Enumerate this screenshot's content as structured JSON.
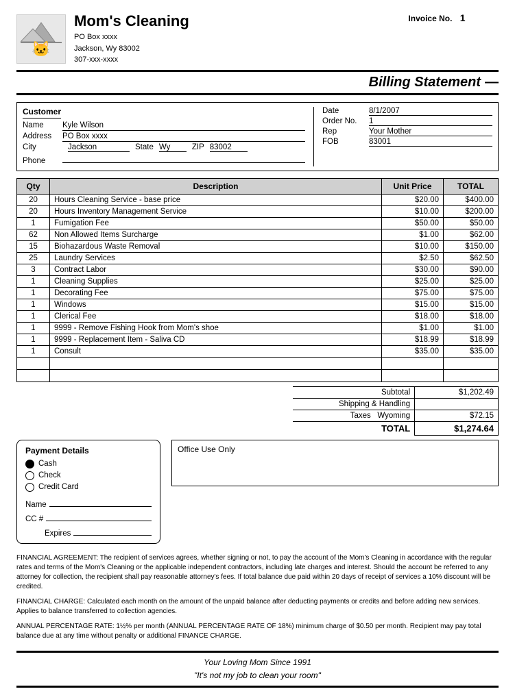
{
  "company": {
    "name": "Mom's Cleaning",
    "address_line1": "PO Box xxxx",
    "address_line2": "Jackson, Wy  83002",
    "phone": "307-xxx-xxxx"
  },
  "invoice": {
    "label": "Invoice No.",
    "number": "1"
  },
  "billing_statement_title": "Billing Statement",
  "customer": {
    "section_title": "Customer",
    "name_label": "Name",
    "name_value": "Kyle Wilson",
    "address_label": "Address",
    "address_value": "PO Box xxxx",
    "city_label": "City",
    "city_value": "Jackson",
    "state_label": "State",
    "state_value": "Wy",
    "zip_label": "ZIP",
    "zip_value": "83002",
    "phone_label": "Phone",
    "phone_value": ""
  },
  "order_info": {
    "date_label": "Date",
    "date_value": "8/1/2007",
    "order_no_label": "Order No.",
    "order_no_value": "1",
    "rep_label": "Rep",
    "rep_value": "Your Mother",
    "fob_label": "FOB",
    "fob_value": "83001"
  },
  "table": {
    "headers": [
      "Qty",
      "Description",
      "Unit Price",
      "TOTAL"
    ],
    "rows": [
      {
        "qty": "20",
        "desc": "Hours Cleaning Service - base price",
        "unit_price": "$20.00",
        "total": "$400.00"
      },
      {
        "qty": "20",
        "desc": "Hours Inventory Management Service",
        "unit_price": "$10.00",
        "total": "$200.00"
      },
      {
        "qty": "1",
        "desc": "Fumigation Fee",
        "unit_price": "$50.00",
        "total": "$50.00"
      },
      {
        "qty": "62",
        "desc": "Non Allowed Items Surcharge",
        "unit_price": "$1.00",
        "total": "$62.00"
      },
      {
        "qty": "15",
        "desc": "Biohazardous Waste Removal",
        "unit_price": "$10.00",
        "total": "$150.00"
      },
      {
        "qty": "25",
        "desc": "Laundry Services",
        "unit_price": "$2.50",
        "total": "$62.50"
      },
      {
        "qty": "3",
        "desc": "Contract Labor",
        "unit_price": "$30.00",
        "total": "$90.00"
      },
      {
        "qty": "1",
        "desc": "Cleaning Supplies",
        "unit_price": "$25.00",
        "total": "$25.00"
      },
      {
        "qty": "1",
        "desc": "Decorating Fee",
        "unit_price": "$75.00",
        "total": "$75.00"
      },
      {
        "qty": "1",
        "desc": "Windows",
        "unit_price": "$15.00",
        "total": "$15.00"
      },
      {
        "qty": "1",
        "desc": "Clerical Fee",
        "unit_price": "$18.00",
        "total": "$18.00"
      },
      {
        "qty": "1",
        "desc": "9999 - Remove Fishing Hook from Mom's shoe",
        "unit_price": "$1.00",
        "total": "$1.00"
      },
      {
        "qty": "1",
        "desc": "9999 - Replacement Item - Saliva CD",
        "unit_price": "$18.99",
        "total": "$18.99"
      },
      {
        "qty": "1",
        "desc": "Consult",
        "unit_price": "$35.00",
        "total": "$35.00"
      }
    ]
  },
  "subtotals": {
    "subtotal_label": "Subtotal",
    "subtotal_value": "$1,202.49",
    "shipping_label": "Shipping & Handling",
    "shipping_value": "",
    "taxes_label": "Taxes",
    "taxes_state": "Wyoming",
    "taxes_value": "$72.15",
    "total_label": "TOTAL",
    "total_value": "$1,274.64"
  },
  "payment": {
    "title": "Payment Details",
    "options": [
      "Cash",
      "Check",
      "Credit Card"
    ],
    "selected": "Cash",
    "name_label": "Name",
    "cc_label": "CC #",
    "expires_label": "Expires"
  },
  "office_use": {
    "label": "Office Use Only"
  },
  "legal": {
    "para1": "FINANCIAL AGREEMENT:  The recipient of services agrees, whether signing or not, to pay the account of the Mom's Cleaning in accordance with the regular rates and terms of the Mom's Cleaning or the applicable independent contractors, including late charges and interest.  Should the account be referred to any attorney for collection, the recipient shall pay reasonable attorney's fees. If total balance due paid within 20 days of receipt of services a 10% discount will be credited.",
    "para2": "FINANCIAL CHARGE:  Calculated each month on the amount of the unpaid balance after deducting payments or credits and before adding new services.  Applies to balance transferred to collection agencies.",
    "para3": "ANNUAL PERCENTAGE RATE: 1½% per month (ANNUAL PERCENTAGE RATE OF 18%) minimum charge of $0.50 per month. Recipient may pay total balance due at any time without penalty or additional FINANCE CHARGE."
  },
  "footer": {
    "line1": "Your Loving Mom Since 1991",
    "line2": "\"It's not my job to clean your room\""
  }
}
